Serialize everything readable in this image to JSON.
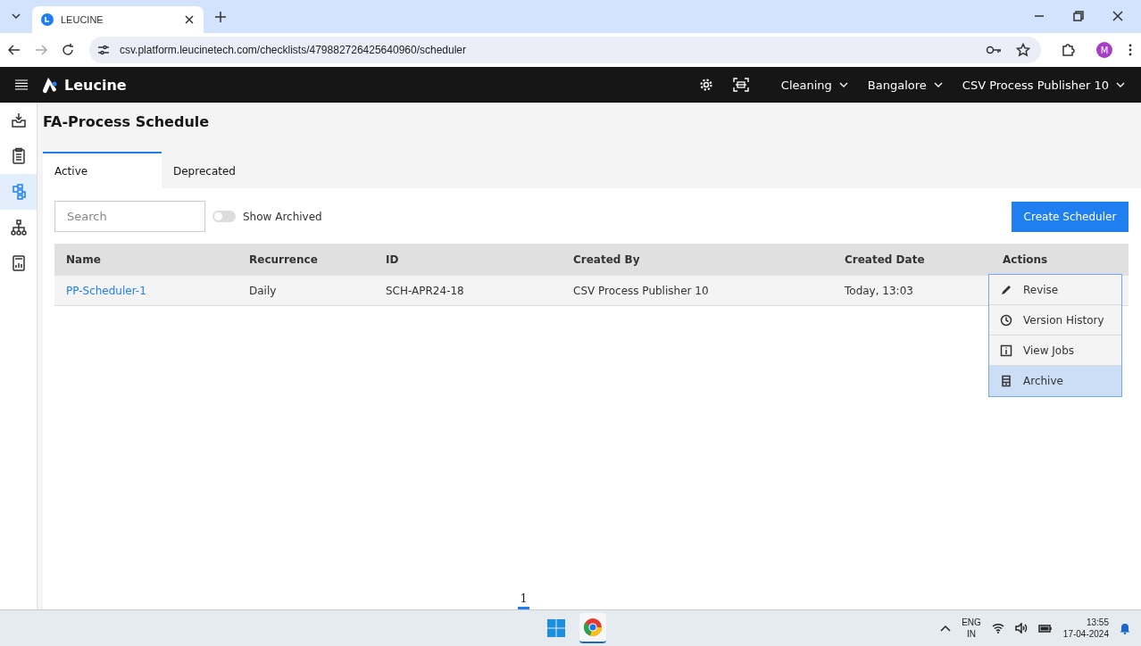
{
  "browser": {
    "tab_title": "LEUCINE",
    "url": "csv.platform.leucinetech.com/checklists/479882726425640960/scheduler",
    "profile_initial": "M"
  },
  "header": {
    "brand": "Leucine",
    "selectors": [
      "Cleaning",
      "Bangalore",
      "CSV Process Publisher 10"
    ]
  },
  "sidebar": {
    "items": [
      {
        "selected": false
      },
      {
        "selected": false
      },
      {
        "selected": true
      },
      {
        "selected": false
      },
      {
        "selected": false
      }
    ]
  },
  "page": {
    "title": "FA-Process Schedule",
    "tabs": [
      {
        "label": "Active",
        "selected": true
      },
      {
        "label": "Deprecated",
        "selected": false
      }
    ],
    "search": {
      "placeholder": "Search"
    },
    "show_archived": {
      "label": "Show Archived",
      "on": false
    },
    "create_button": "Create Scheduler",
    "table": {
      "columns": [
        "Name",
        "Recurrence",
        "ID",
        "Created By",
        "Created Date",
        "Actions"
      ],
      "rows": [
        {
          "cells": [
            "PP-Scheduler-1",
            "Daily",
            "SCH-APR24-18",
            "CSV Process Publisher 10",
            "Today, 13:03"
          ]
        }
      ]
    },
    "actions_menu": [
      {
        "kind": "edit",
        "label": "Revise",
        "selected": false
      },
      {
        "kind": "history",
        "label": "Version History",
        "selected": false
      },
      {
        "kind": "info",
        "label": "View Jobs",
        "selected": false
      },
      {
        "kind": "archive",
        "label": "Archive",
        "selected": true
      }
    ],
    "pagination": [
      "1"
    ]
  },
  "taskbar": {
    "language": "ENG",
    "region": "IN",
    "time": "13:55",
    "date": "17-04-2024"
  }
}
